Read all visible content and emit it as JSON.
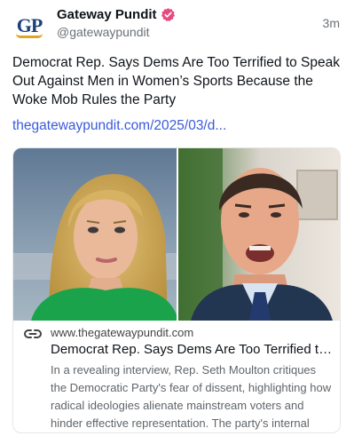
{
  "post": {
    "avatar_text": "GP",
    "display_name": "Gateway Pundit",
    "handle": "@gatewaypundit",
    "timestamp": "3m",
    "text": "Democrat Rep. Says Dems Are Too Terrified to Speak Out Against Men in Women’s Sports Because the Woke Mob Rules the Party",
    "link": "thegatewaypundit.com/2025/03/d..."
  },
  "card": {
    "domain": "www.thegatewaypundit.com",
    "title": "Democrat Rep. Says Dems Are Too Terrified to Speak Out Against Men in Women’s Sports Because the Woke Mob Rules the Party",
    "description": "In a revealing interview, Rep. Seth Moulton critiques the Democratic Party's fear of dissent, highlighting how radical ideologies alienate mainstream voters and hinder effective representation. The party's internal struggles..."
  },
  "colors": {
    "brand": "#1d3f7a",
    "brand_accent": "#e0a526",
    "verified": "#e84a7f",
    "link": "#3b5bdb",
    "muted": "#6b7075"
  },
  "icons": [
    "verified-badge-icon",
    "link-icon"
  ]
}
